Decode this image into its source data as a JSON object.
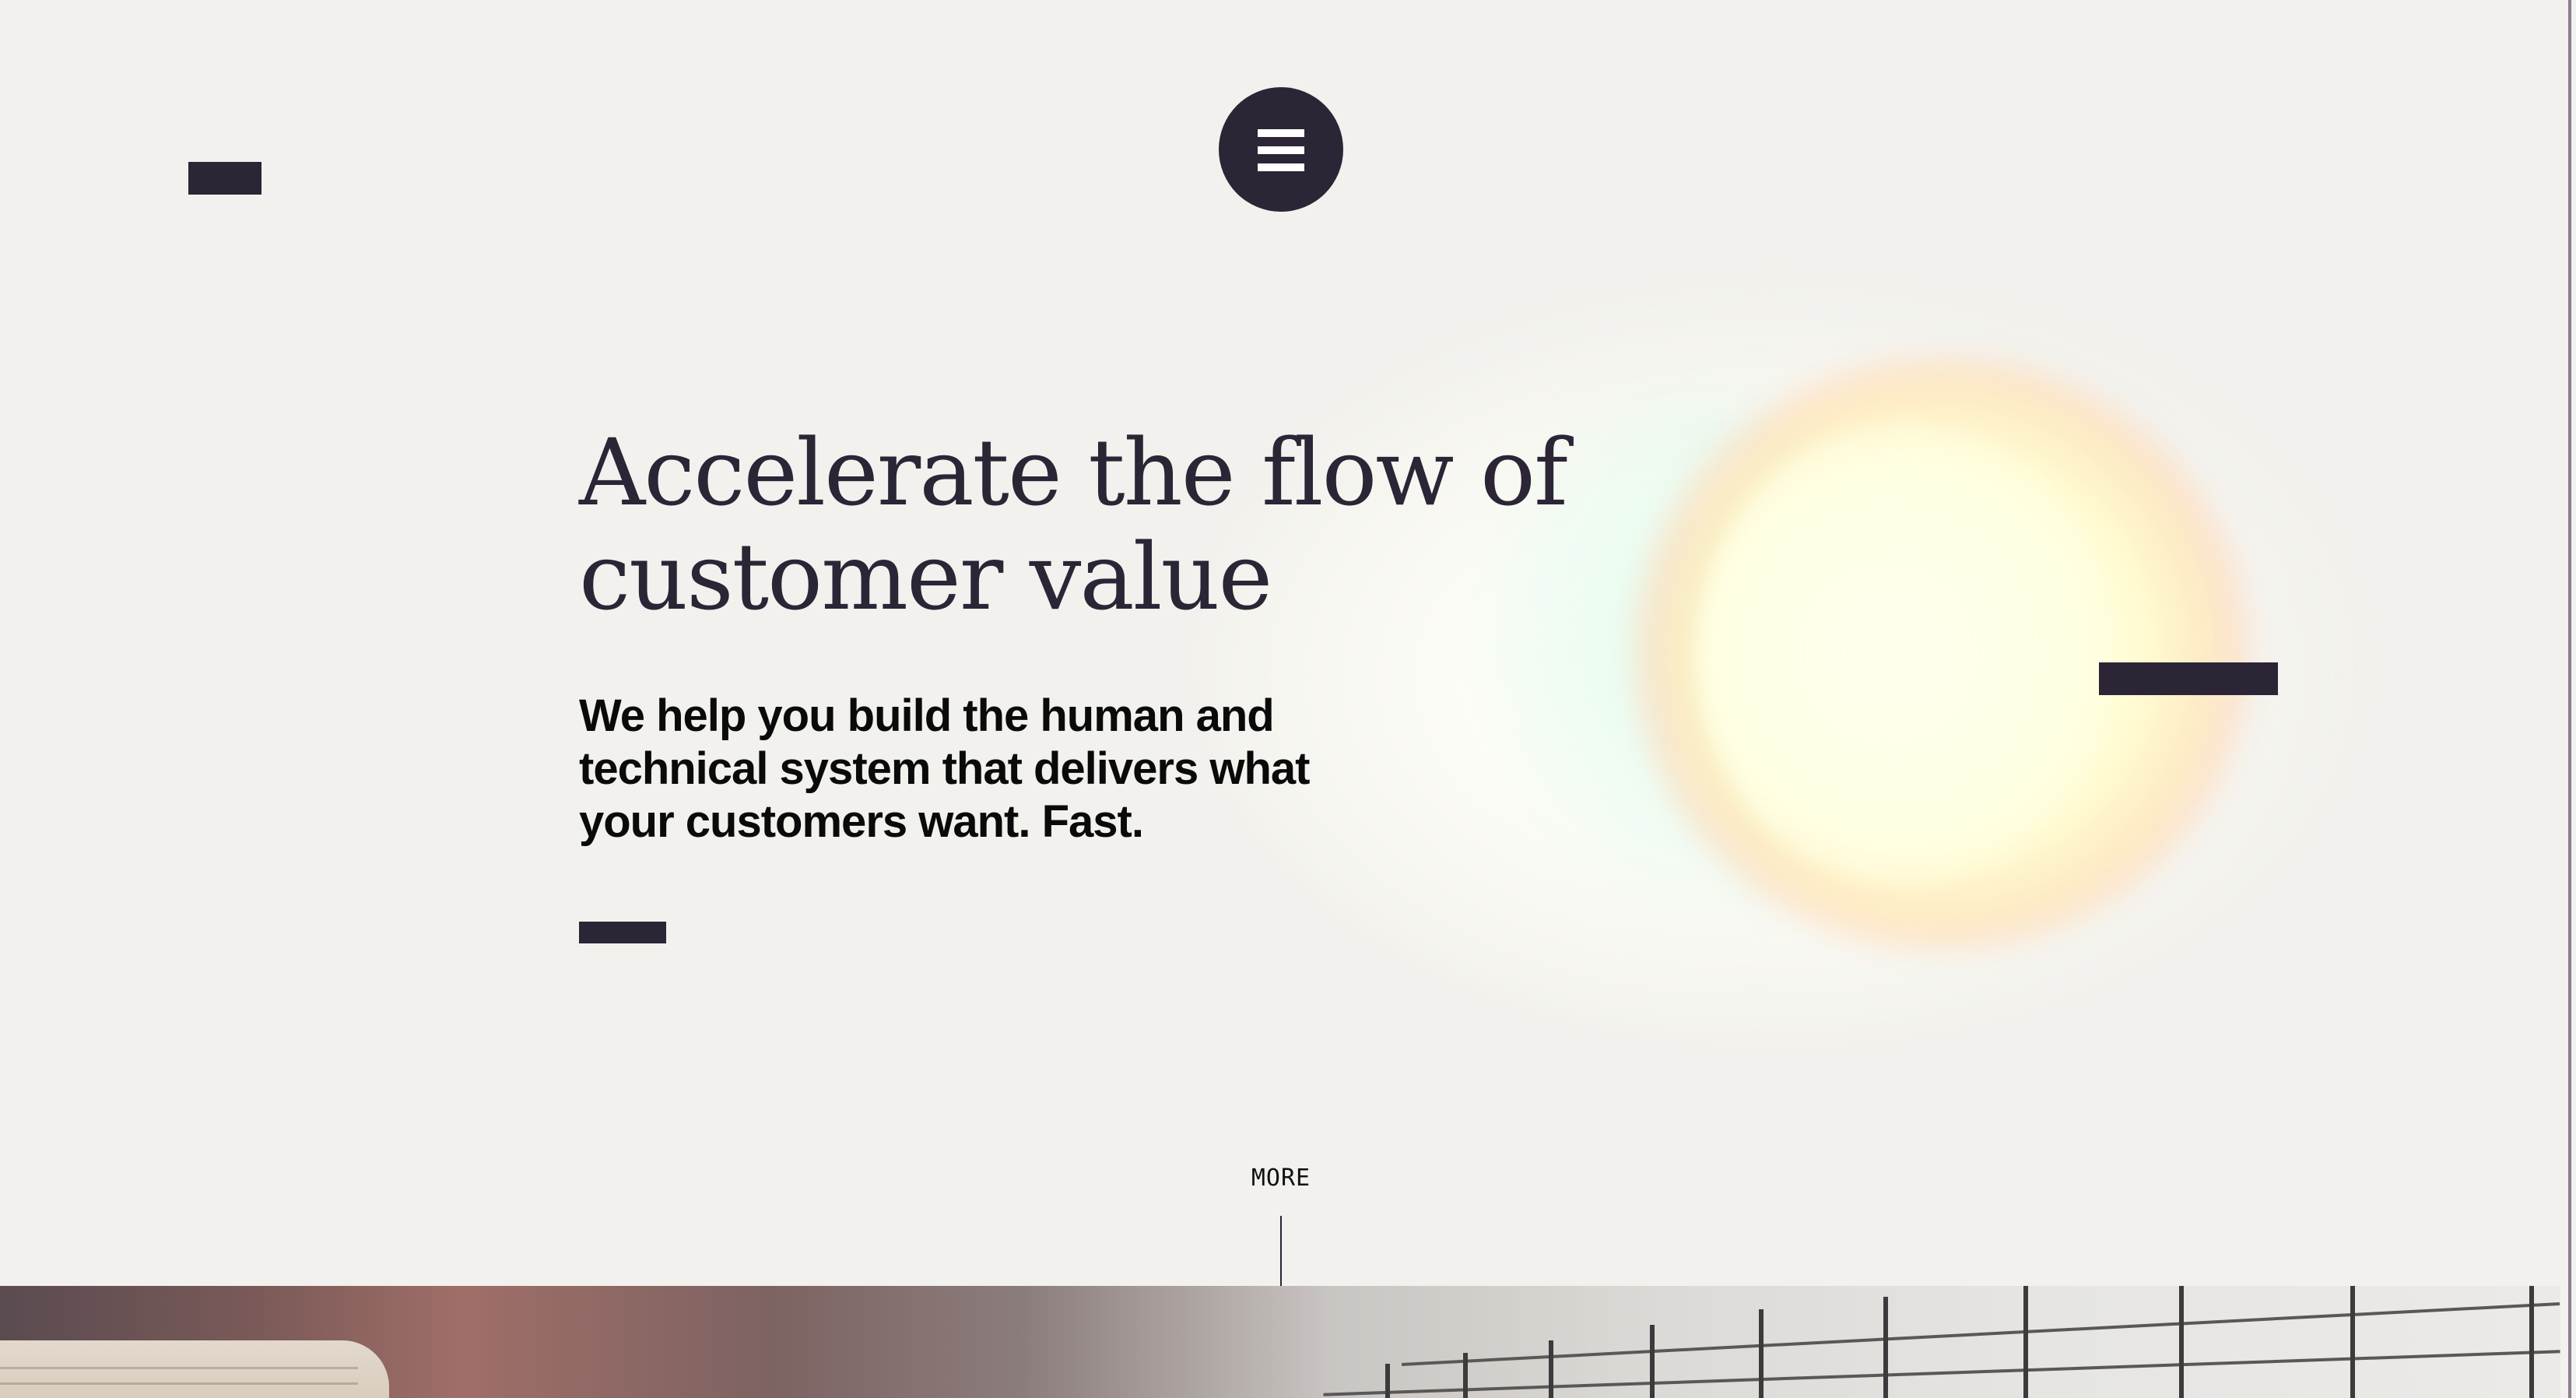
{
  "header": {
    "logo_icon": "logo-bar-icon",
    "menu_icon": "hamburger-menu-icon"
  },
  "hero": {
    "headline": "Accelerate the flow of customer value",
    "subheadline": "We help you build the human and technical system that delivers what your customers want. Fast.",
    "cta_icon": "cta-bar-icon"
  },
  "scroll": {
    "more_label": "MORE"
  },
  "colors": {
    "background": "#f2f1ed",
    "brand_dark": "#2b2536",
    "body_text": "#0a0a0a"
  }
}
